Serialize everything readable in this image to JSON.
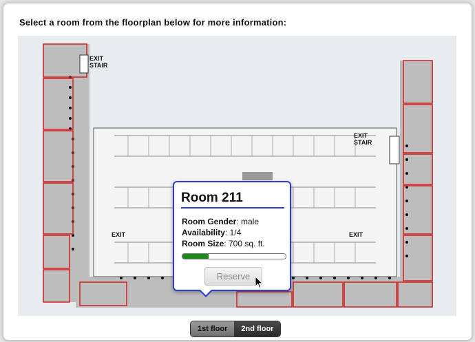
{
  "instructions": "Select a room from the floorplan below for more information:",
  "stair_labels": [
    "EXIT",
    "STAIR"
  ],
  "exit_label": "EXIT",
  "popup": {
    "title": "Room 211",
    "gender_label": "Room Gender",
    "gender_value": ": male",
    "availability_label": "Availability",
    "availability_value": ": 1/4",
    "size_label": "Room Size",
    "size_value": ": 700 sq. ft.",
    "occupancy_fraction": 0.25,
    "reserve_label": "Reserve"
  },
  "floors": [
    {
      "label": "1st floor",
      "active": true
    },
    {
      "label": "2nd floor",
      "active": false
    }
  ],
  "colors": {
    "accent": "#2a3fd1",
    "room_outline": "#d42020",
    "progress": "#1e8a1e"
  }
}
